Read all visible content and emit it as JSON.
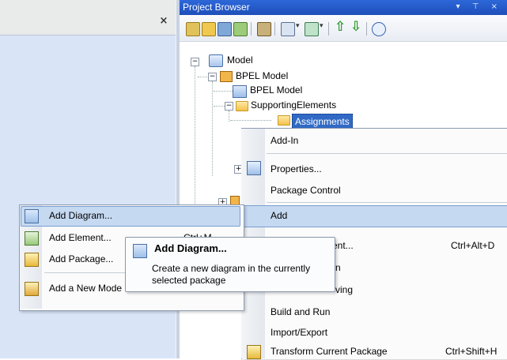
{
  "left_panel": {
    "close_label": "×"
  },
  "project_browser": {
    "title": "Project Browser",
    "title_controls": "▾ ⊤ ×",
    "tree": {
      "model": "Model",
      "bpel_model_pkg": "BPEL Model",
      "bpel_model_diagram": "BPEL Model",
      "supporting_elements": "SupportingElements",
      "assignments": "Assignments"
    }
  },
  "context_menu": {
    "items": [
      {
        "label": "Add-In",
        "shortcut": ""
      },
      {
        "label": "Properties...",
        "shortcut": ""
      },
      {
        "label": "Package Control",
        "shortcut": ""
      },
      {
        "label": "Add",
        "shortcut": ""
      },
      {
        "label": "ent...",
        "shortcut": "Ctrl+Alt+D"
      },
      {
        "label": "n",
        "shortcut": ""
      },
      {
        "label": "ving",
        "shortcut": ""
      },
      {
        "label": "Build and Run",
        "shortcut": ""
      },
      {
        "label": "Import/Export",
        "shortcut": ""
      },
      {
        "label": "Transform Current Package",
        "shortcut": "Ctrl+Shift+H"
      }
    ]
  },
  "add_submenu": {
    "items": [
      {
        "label": "Add Diagram...",
        "shortcut": ""
      },
      {
        "label": "Add Element...",
        "shortcut": "Ctrl+M"
      },
      {
        "label": "Add Package...",
        "shortcut": ""
      },
      {
        "label": "Add a New Mode",
        "shortcut": ""
      }
    ]
  },
  "tooltip": {
    "title": "Add Diagram...",
    "body": "Create a new diagram in the currently selected package"
  },
  "colors": {
    "highlight": "#c5d9f1",
    "title_bar": "#2d67d8",
    "selection": "#316ac5"
  }
}
